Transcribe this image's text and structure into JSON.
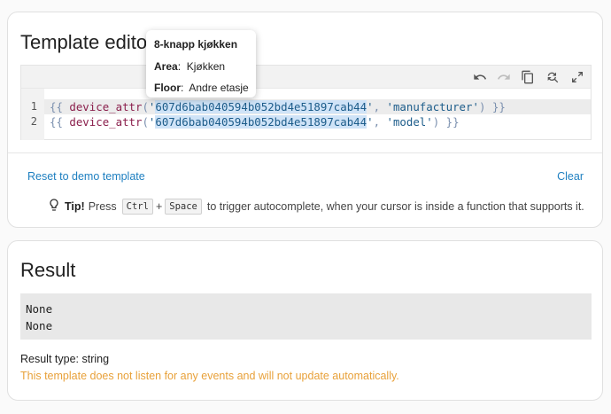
{
  "editor_card": {
    "title": "Template editor",
    "toolbar": {
      "undo_icon": "undo-icon",
      "redo_icon": "redo-icon",
      "copy_icon": "copy-icon",
      "search_replace_icon": "search-replace-icon",
      "fullscreen_icon": "fullscreen-icon"
    },
    "line_numbers": [
      "1",
      "2"
    ],
    "code_lines": [
      {
        "open": "{{ ",
        "fn": "device_attr",
        "paren_open": "(",
        "q1": "'",
        "device_id": "607d6bab040594b052bd4e51897cab44",
        "q2": "'",
        "comma": ", ",
        "arg": "'manufacturer'",
        "paren_close": ")",
        "close": " }}"
      },
      {
        "open": "{{ ",
        "fn": "device_attr",
        "paren_open": "(",
        "q1": "'",
        "device_id": "607d6bab040594b052bd4e51897cab44",
        "q2": "'",
        "comma": ", ",
        "arg": "'model'",
        "paren_close": ")",
        "close": " }}"
      }
    ],
    "reset_label": "Reset to demo template",
    "clear_label": "Clear",
    "tip": {
      "icon": "lightbulb-icon",
      "label": "Tip!",
      "press": "Press",
      "key1": "Ctrl",
      "plus": "+",
      "key2": "Space",
      "rest": "to trigger autocomplete, when your cursor is inside a function that supports it."
    }
  },
  "tooltip": {
    "title": "8-knapp kjøkken",
    "area_label": "Area",
    "area_value": "Kjøkken",
    "floor_label": "Floor",
    "floor_value": "Andre etasje"
  },
  "result_card": {
    "title": "Result",
    "output_lines": [
      "None",
      "None"
    ],
    "result_type": "Result type: string",
    "warning": "This template does not listen for any events and will not update automatically."
  },
  "colors": {
    "link": "#1e7fc0",
    "warning": "#e8a13a",
    "selection": "#cfe3f7"
  }
}
